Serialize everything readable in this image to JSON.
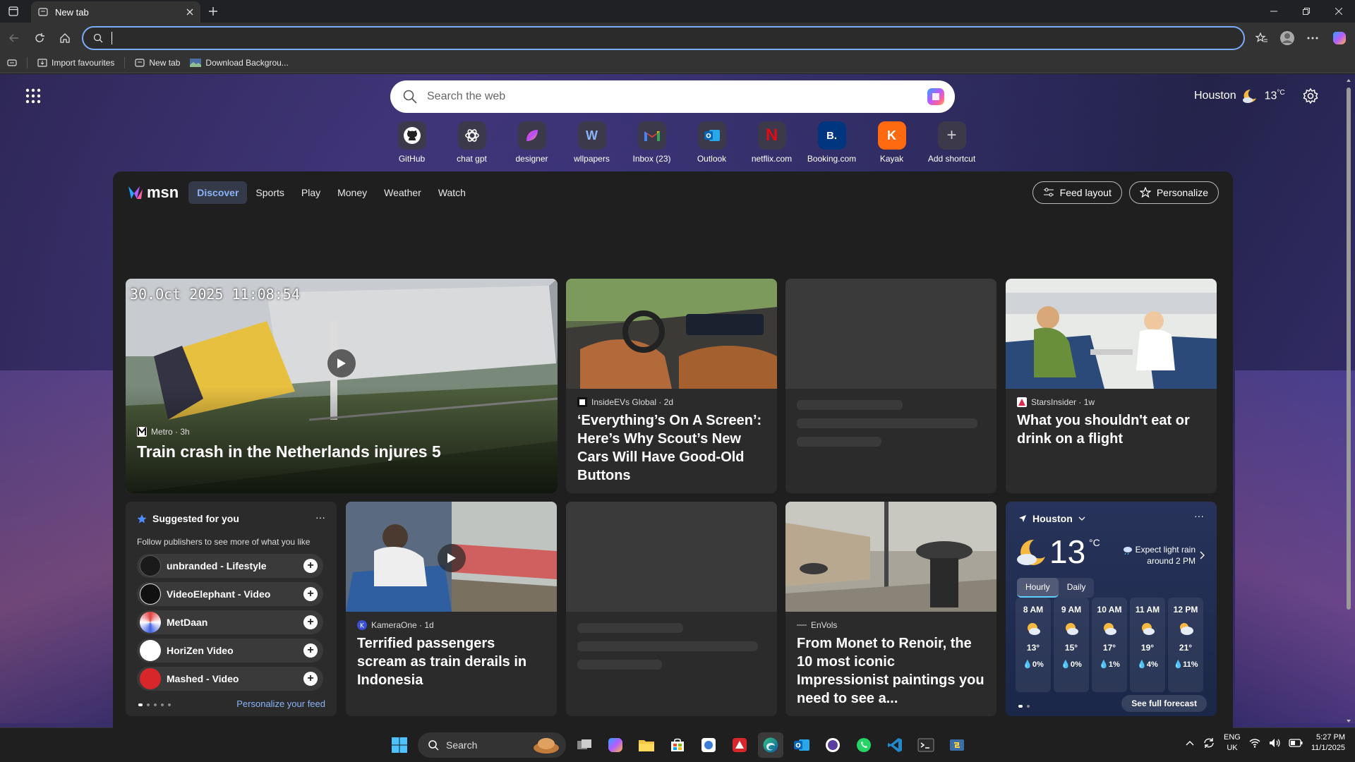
{
  "browser": {
    "tab_title": "New tab",
    "address_value": "",
    "bookmarks": [
      "Import favourites",
      "New tab",
      "Download Backgrou..."
    ]
  },
  "newtab": {
    "search_placeholder": "Search the web",
    "weather_city": "Houston",
    "weather_temp": "13",
    "weather_unit": "°C",
    "shortcuts": [
      {
        "label": "GitHub",
        "glyph": "",
        "color": "#fff"
      },
      {
        "label": "chat gpt",
        "glyph": "",
        "color": "#fff"
      },
      {
        "label": "designer",
        "glyph": "",
        "color": "#c13cff"
      },
      {
        "label": "wllpapers",
        "glyph": "W",
        "color": "#8ab4f8"
      },
      {
        "label": "Inbox (23)",
        "glyph": "M",
        "color": "#ea4335"
      },
      {
        "label": "Outlook",
        "glyph": "O",
        "color": "#0078d4"
      },
      {
        "label": "netflix.com",
        "glyph": "N",
        "color": "#e50914"
      },
      {
        "label": "Booking.com",
        "glyph": "B.",
        "color": "#003580"
      },
      {
        "label": "Kayak",
        "glyph": "K",
        "color": "#ff690f"
      },
      {
        "label": "Add shortcut",
        "glyph": "+",
        "color": "#ccc"
      }
    ]
  },
  "feed": {
    "brand": "msn",
    "tabs": [
      "Discover",
      "Sports",
      "Play",
      "Money",
      "Weather",
      "Watch"
    ],
    "feed_layout": "Feed layout",
    "personalize": "Personalize",
    "cards": {
      "hero": {
        "timestamp_overlay": "30.Oct 2025  11:08:54",
        "publisher": "Metro · 3h",
        "title": "Train crash in the Netherlands injures 5"
      },
      "car": {
        "publisher": "InsideEVs Global · 2d",
        "title": "‘Everything’s On A Screen’: Here’s Why Scout’s New Cars Will Have Good-Old Buttons"
      },
      "flight": {
        "publisher": "StarsInsider · 1w",
        "title": "What you shouldn't eat or drink on a flight"
      },
      "train": {
        "publisher": "KameraOne · 1d",
        "title": "Terrified passengers scream as train derails in Indonesia"
      },
      "art": {
        "publisher": "EnVols",
        "title": "From Monet to Renoir, the 10 most iconic Impressionist paintings you need to see a..."
      }
    },
    "suggested": {
      "title": "Suggested for you",
      "subtitle": "Follow publishers to see more of what you like",
      "publishers": [
        "unbranded - Lifestyle",
        "VideoElephant - Video",
        "MetDaan",
        "HoriZen Video",
        "Mashed - Video"
      ],
      "personalize_link": "Personalize your feed",
      "more": "···"
    },
    "weather": {
      "city": "Houston",
      "temp": "13",
      "unit": "°C",
      "alert": "Expect light rain around 2 PM",
      "tabs": [
        "Hourly",
        "Daily"
      ],
      "hours": [
        {
          "time": "8 AM",
          "temp": "13°",
          "precip": "0%"
        },
        {
          "time": "9 AM",
          "temp": "15°",
          "precip": "0%"
        },
        {
          "time": "10 AM",
          "temp": "17°",
          "precip": "1%"
        },
        {
          "time": "11 AM",
          "temp": "19°",
          "precip": "4%"
        },
        {
          "time": "12 PM",
          "temp": "21°",
          "precip": "11%"
        }
      ],
      "forecast_button": "See full forecast",
      "more": "···"
    }
  },
  "taskbar": {
    "search_label": "Search",
    "lang_1": "ENG",
    "lang_2": "UK",
    "time": "5:27 PM",
    "date": "11/1/2025"
  },
  "colors": {
    "accent": "#7cacf8",
    "link": "#8ab4f8"
  }
}
